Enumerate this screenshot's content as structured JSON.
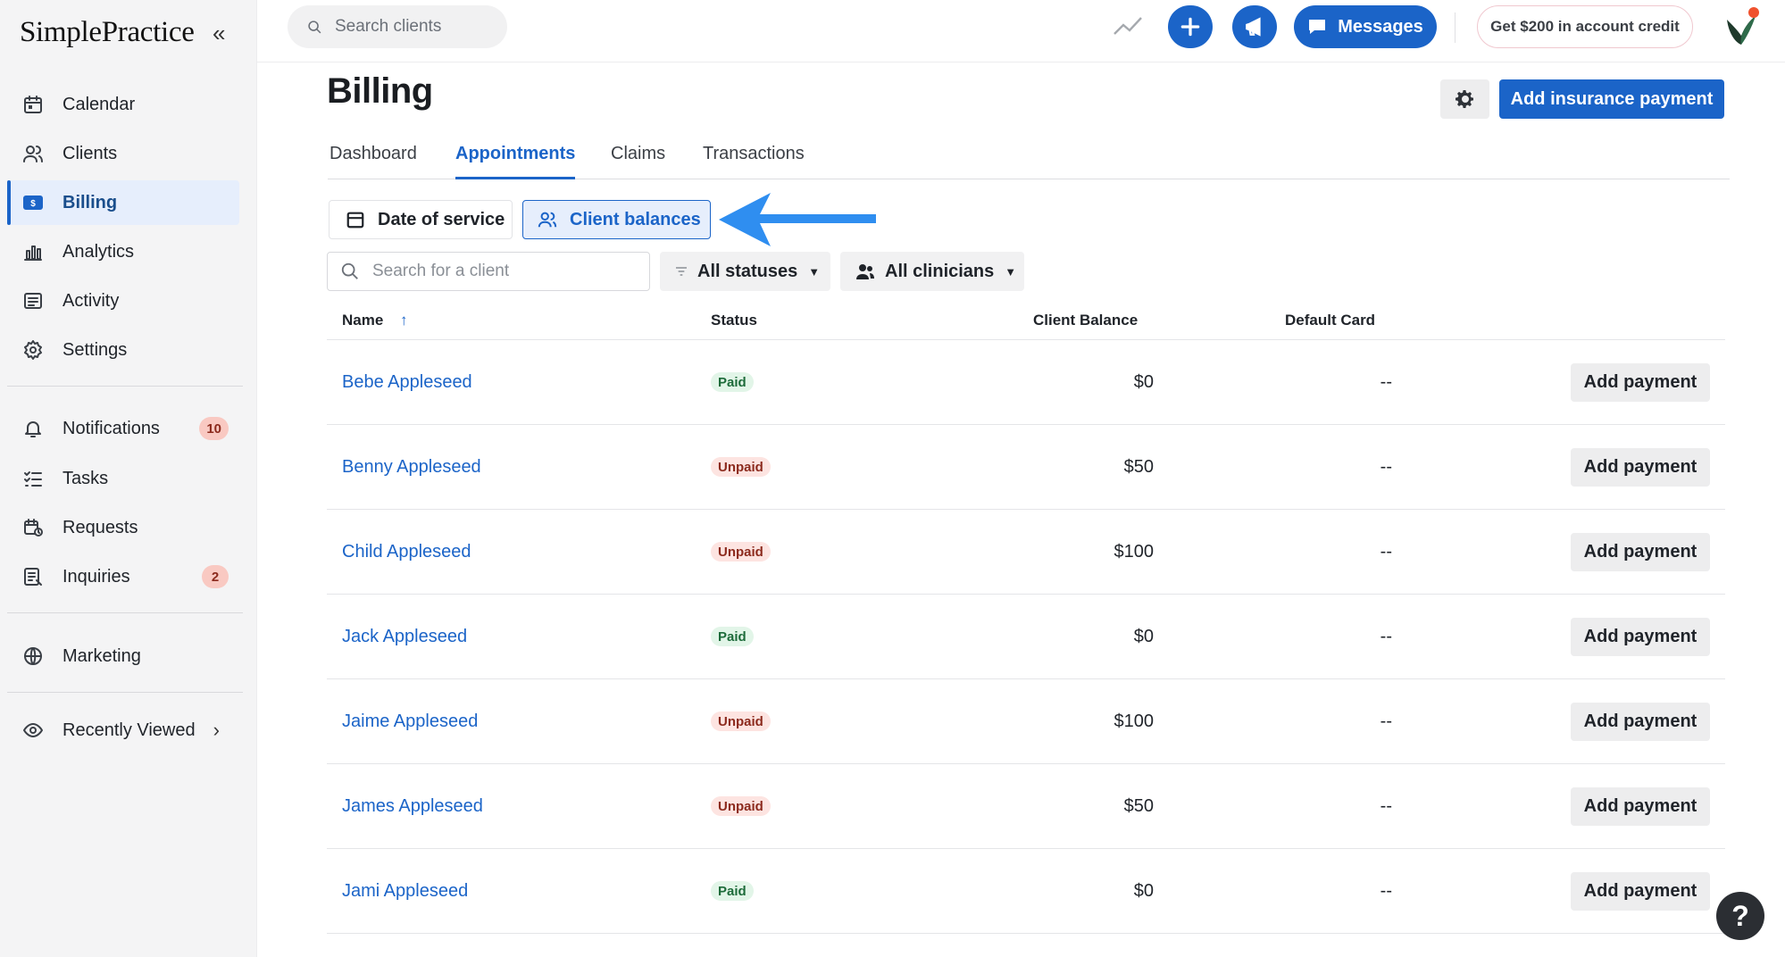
{
  "app": {
    "logo": "SimplePractice",
    "collapse_icon": "«"
  },
  "sidebar": {
    "items": [
      {
        "label": "Calendar",
        "icon": "calendar-icon"
      },
      {
        "label": "Clients",
        "icon": "clients-icon"
      },
      {
        "label": "Billing",
        "icon": "billing-icon",
        "active": true
      },
      {
        "label": "Analytics",
        "icon": "analytics-icon"
      },
      {
        "label": "Activity",
        "icon": "activity-icon"
      },
      {
        "label": "Settings",
        "icon": "settings-icon"
      }
    ],
    "items2": [
      {
        "label": "Notifications",
        "icon": "bell-icon",
        "badge": "10"
      },
      {
        "label": "Tasks",
        "icon": "tasks-icon"
      },
      {
        "label": "Requests",
        "icon": "requests-icon"
      },
      {
        "label": "Inquiries",
        "icon": "inquiries-icon",
        "badge": "2"
      }
    ],
    "marketing": {
      "label": "Marketing",
      "icon": "globe-icon"
    },
    "recently_viewed": {
      "label": "Recently Viewed",
      "icon": "eye-icon",
      "chevron": "›"
    }
  },
  "topbar": {
    "search_placeholder": "Search clients",
    "messages_label": "Messages",
    "credit_label": "Get $200 in account credit"
  },
  "page": {
    "title": "Billing",
    "add_insurance_label": "Add insurance payment"
  },
  "tabs": [
    "Dashboard",
    "Appointments",
    "Claims",
    "Transactions"
  ],
  "active_tab": "Appointments",
  "view_toggle": {
    "date_of_service": "Date of service",
    "client_balances": "Client balances"
  },
  "filters": {
    "search_placeholder": "Search for a client",
    "statuses": "All statuses",
    "clinicians": "All clinicians",
    "caret": "▼"
  },
  "table": {
    "headers": {
      "name": "Name",
      "status": "Status",
      "balance": "Client Balance",
      "card": "Default Card"
    },
    "sort_arrow": "↑",
    "action_label": "Add payment",
    "rows": [
      {
        "name": "Bebe Appleseed",
        "status": "Paid",
        "balance": "$0",
        "card": "--"
      },
      {
        "name": "Benny Appleseed",
        "status": "Unpaid",
        "balance": "$50",
        "card": "--"
      },
      {
        "name": "Child Appleseed",
        "status": "Unpaid",
        "balance": "$100",
        "card": "--"
      },
      {
        "name": "Jack Appleseed",
        "status": "Paid",
        "balance": "$0",
        "card": "--"
      },
      {
        "name": "Jaime Appleseed",
        "status": "Unpaid",
        "balance": "$100",
        "card": "--"
      },
      {
        "name": "James Appleseed",
        "status": "Unpaid",
        "balance": "$50",
        "card": "--"
      },
      {
        "name": "Jami Appleseed",
        "status": "Paid",
        "balance": "$0",
        "card": "--"
      }
    ]
  },
  "help": {
    "label": "?"
  },
  "colors": {
    "brand": "#1b64c8",
    "paid": "#1d6b3a",
    "unpaid": "#8c2a1d",
    "annotation_arrow": "#2f8ef0"
  }
}
